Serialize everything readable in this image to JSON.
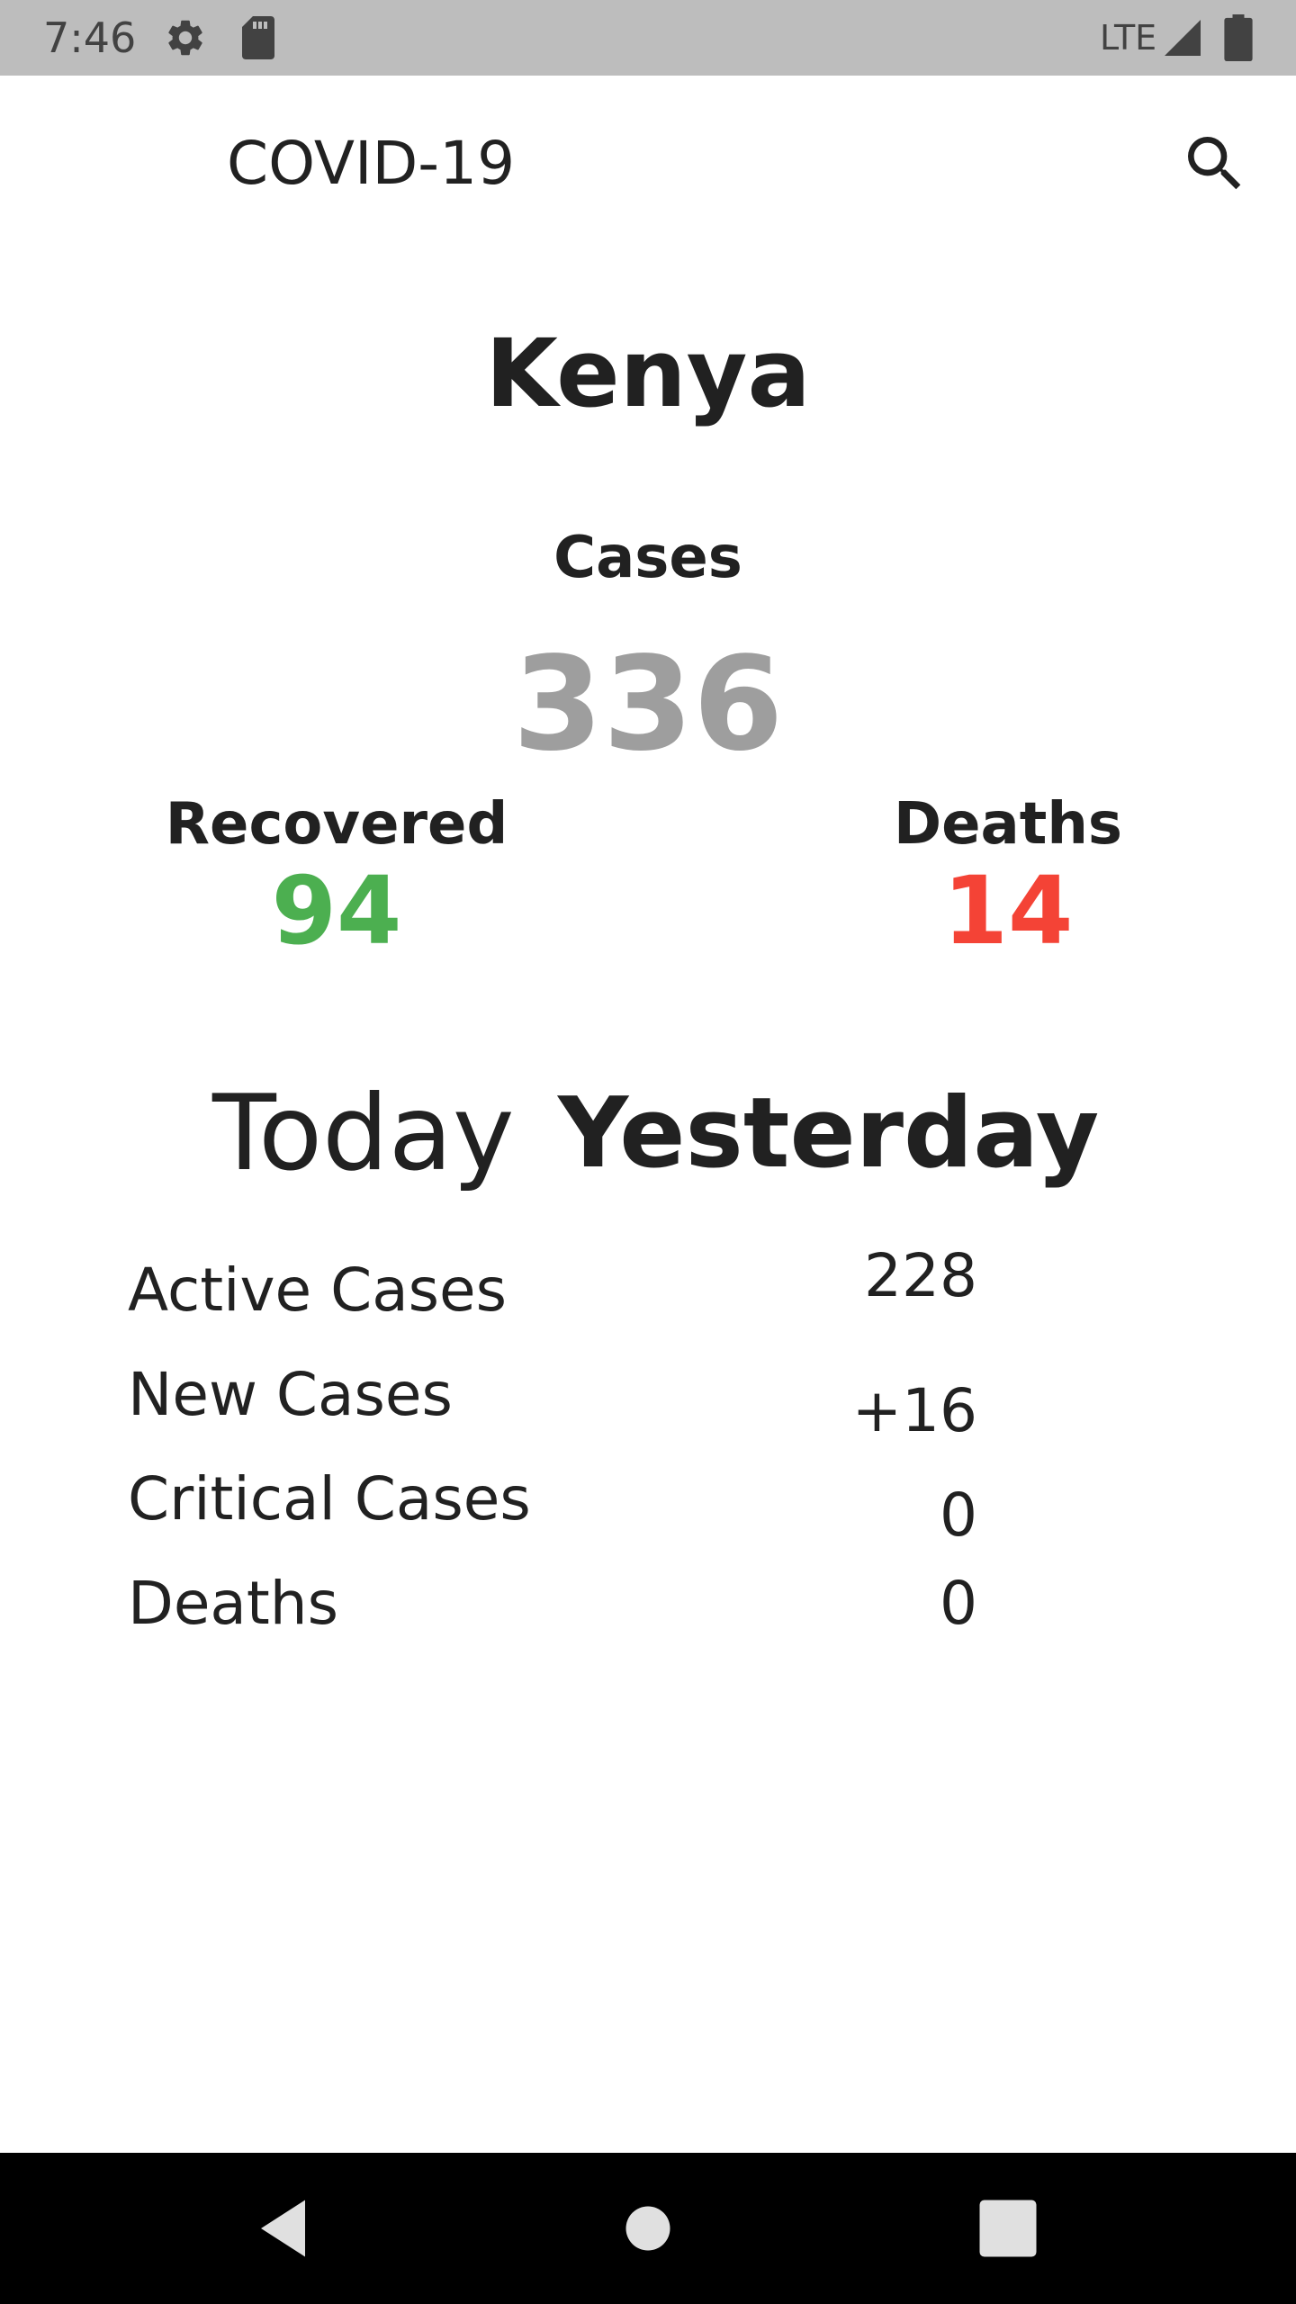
{
  "status_bar": {
    "time": "7:46",
    "network": "LTE",
    "icons": [
      "gear-icon",
      "sd-card-icon",
      "signal-icon",
      "battery-icon"
    ]
  },
  "app_bar": {
    "title": "COVID-19",
    "search_icon": "search-icon"
  },
  "summary": {
    "country": "Kenya",
    "cases_label": "Cases",
    "cases_value": "336",
    "recovered_label": "Recovered",
    "recovered_value": "94",
    "deaths_label": "Deaths",
    "deaths_value": "14"
  },
  "tabs": [
    {
      "label": "Today",
      "selected": false
    },
    {
      "label": "Yesterday",
      "selected": true
    }
  ],
  "stats": [
    {
      "label": "Active Cases",
      "value": "228"
    },
    {
      "label": "New Cases",
      "value": "+16"
    },
    {
      "label": "Critical Cases",
      "value": "0"
    },
    {
      "label": "Deaths",
      "value": "0"
    }
  ],
  "colors": {
    "status_bar": "#bdbdbd",
    "cases": "#9e9e9e",
    "recovered": "#4caf50",
    "deaths": "#f44336",
    "nav_bar": "#000000"
  },
  "nav_bar": {
    "icons": [
      "back-icon",
      "home-icon",
      "recents-icon"
    ]
  }
}
